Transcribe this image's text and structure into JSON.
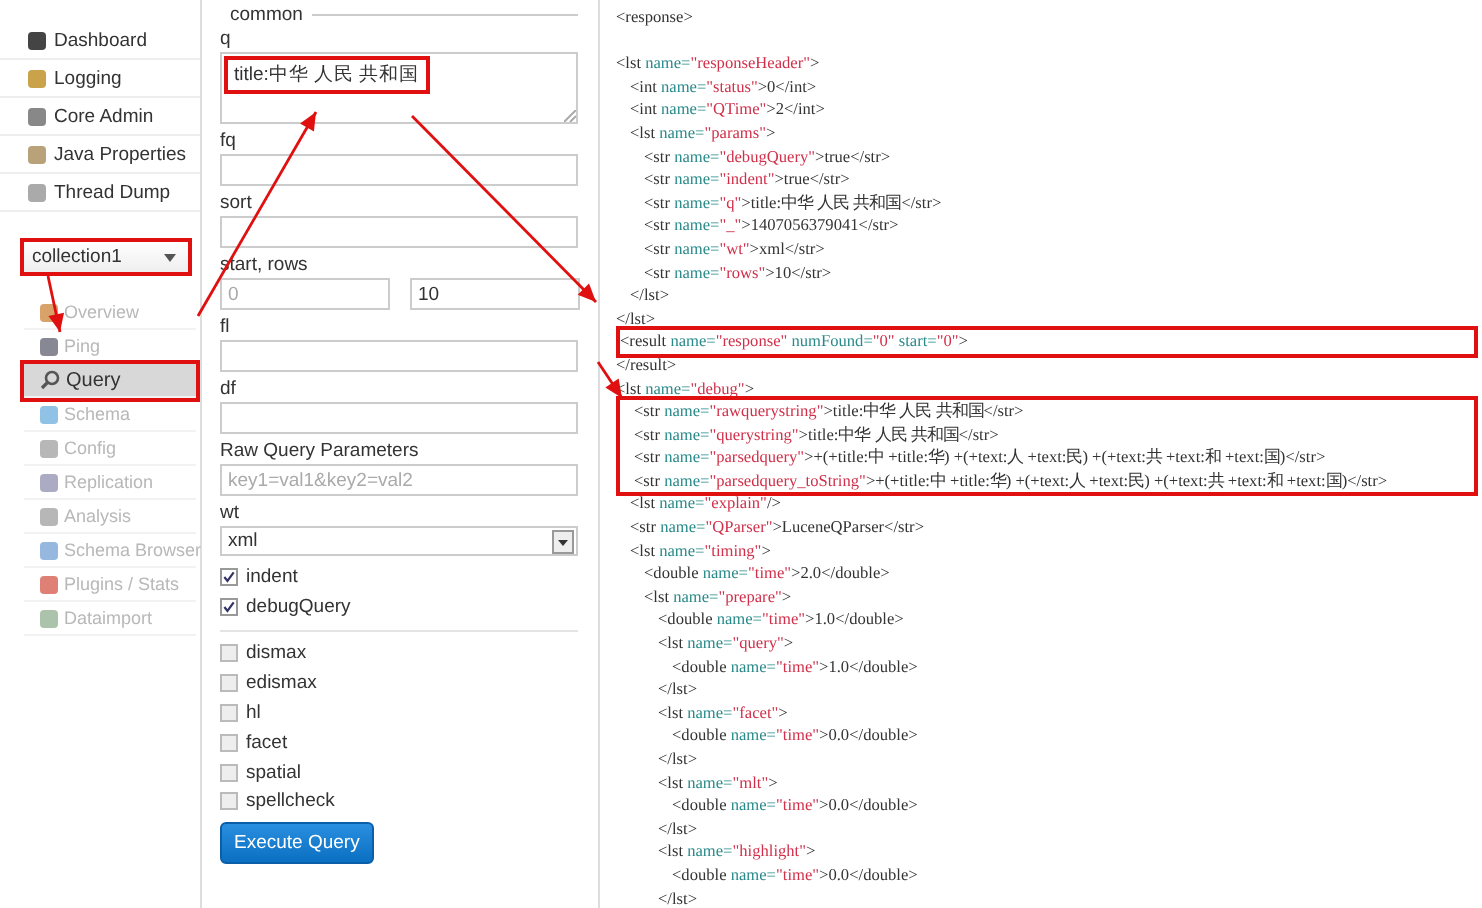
{
  "sidebar": {
    "items": [
      {
        "label": "Dashboard"
      },
      {
        "label": "Logging"
      },
      {
        "label": "Core Admin"
      },
      {
        "label": "Java Properties"
      },
      {
        "label": "Thread Dump"
      }
    ],
    "core_selector": {
      "value": "collection1",
      "highlighted": true
    },
    "core_items": [
      {
        "label": "Overview",
        "selected": false,
        "highlighted": false
      },
      {
        "label": "Ping",
        "selected": false,
        "highlighted": false
      },
      {
        "label": "Query",
        "selected": true,
        "highlighted": true
      },
      {
        "label": "Schema",
        "selected": false,
        "highlighted": false
      },
      {
        "label": "Config",
        "selected": false,
        "highlighted": false
      },
      {
        "label": "Replication",
        "selected": false,
        "highlighted": false
      },
      {
        "label": "Analysis",
        "selected": false,
        "highlighted": false
      },
      {
        "label": "Schema Browser",
        "selected": false,
        "highlighted": false
      },
      {
        "label": "Plugins / Stats",
        "selected": false,
        "highlighted": false
      },
      {
        "label": "Dataimport",
        "selected": false,
        "highlighted": false
      }
    ]
  },
  "form": {
    "legend": "common",
    "fields": [
      {
        "kind": "textarea",
        "label": "q",
        "value": "title:中华 人民 共和国",
        "highlighted": true
      },
      {
        "kind": "text",
        "label": "fq",
        "highlighted": false
      },
      {
        "kind": "text",
        "label": "sort",
        "highlighted": false
      },
      {
        "kind": "pair",
        "label": "start, rows",
        "inputs": [
          {
            "placeholder": "0"
          },
          {
            "value": "10"
          }
        ]
      },
      {
        "kind": "text",
        "label": "fl",
        "highlighted": false
      },
      {
        "kind": "text",
        "label": "df",
        "highlighted": false
      },
      {
        "kind": "text",
        "label": "Raw Query Parameters",
        "placeholder": "key1=val1&key2=val2",
        "highlighted": false
      },
      {
        "kind": "select",
        "label": "wt",
        "value": "xml"
      },
      {
        "kind": "checkbox",
        "label": "indent",
        "checked": true
      },
      {
        "kind": "checkbox",
        "label": "debugQuery",
        "checked": true
      },
      {
        "kind": "divider"
      },
      {
        "kind": "checkbox",
        "label": "dismax",
        "checked": false
      },
      {
        "kind": "checkbox",
        "label": "edismax",
        "checked": false
      },
      {
        "kind": "checkbox",
        "label": "hl",
        "checked": false
      },
      {
        "kind": "checkbox",
        "label": "facet",
        "checked": false
      },
      {
        "kind": "checkbox",
        "label": "spatial",
        "checked": false
      },
      {
        "kind": "checkbox",
        "label": "spellcheck",
        "checked": false
      },
      {
        "kind": "button",
        "label": "Execute Query"
      }
    ]
  },
  "response": {
    "nodes": [
      {
        "parts": [
          {
            "kind": "tag",
            "text": "<response>"
          }
        ],
        "children": [
          {
            "parts": [
              {
                "kind": "tag",
                "text": "<lst "
              },
              {
                "kind": "attr",
                "text": "name="
              },
              {
                "kind": "value",
                "text": "\"responseHeader\""
              },
              {
                "kind": "tag",
                "text": ">"
              }
            ],
            "children": [
              {
                "parts": [
                  {
                    "kind": "tag",
                    "text": "<int "
                  },
                  {
                    "kind": "attr",
                    "text": "name="
                  },
                  {
                    "kind": "value",
                    "text": "\"status\""
                  },
                  {
                    "kind": "tag",
                    "text": ">0</int>"
                  }
                ]
              },
              {
                "parts": [
                  {
                    "kind": "tag",
                    "text": "<int "
                  },
                  {
                    "kind": "attr",
                    "text": "name="
                  },
                  {
                    "kind": "value",
                    "text": "\"QTime\""
                  },
                  {
                    "kind": "tag",
                    "text": ">2</int>"
                  }
                ]
              },
              {
                "parts": [
                  {
                    "kind": "tag",
                    "text": "<lst "
                  },
                  {
                    "kind": "attr",
                    "text": "name="
                  },
                  {
                    "kind": "value",
                    "text": "\"params\""
                  },
                  {
                    "kind": "tag",
                    "text": ">"
                  }
                ],
                "children": [
                  {
                    "parts": [
                      {
                        "kind": "tag",
                        "text": "<str "
                      },
                      {
                        "kind": "attr",
                        "text": "name="
                      },
                      {
                        "kind": "value",
                        "text": "\"debugQuery\""
                      },
                      {
                        "kind": "tag",
                        "text": ">true</str>"
                      }
                    ]
                  },
                  {
                    "parts": [
                      {
                        "kind": "tag",
                        "text": "<str "
                      },
                      {
                        "kind": "attr",
                        "text": "name="
                      },
                      {
                        "kind": "value",
                        "text": "\"indent\""
                      },
                      {
                        "kind": "tag",
                        "text": ">true</str>"
                      }
                    ]
                  },
                  {
                    "parts": [
                      {
                        "kind": "tag",
                        "text": "<str "
                      },
                      {
                        "kind": "attr",
                        "text": "name="
                      },
                      {
                        "kind": "value",
                        "text": "\"q\""
                      },
                      {
                        "kind": "tag",
                        "text": ">title:中华 人民 共和国</str>"
                      }
                    ]
                  },
                  {
                    "parts": [
                      {
                        "kind": "tag",
                        "text": "<str "
                      },
                      {
                        "kind": "attr",
                        "text": "name="
                      },
                      {
                        "kind": "value",
                        "text": "\"_\""
                      },
                      {
                        "kind": "tag",
                        "text": ">1407056379041</str>"
                      }
                    ]
                  },
                  {
                    "parts": [
                      {
                        "kind": "tag",
                        "text": "<str "
                      },
                      {
                        "kind": "attr",
                        "text": "name="
                      },
                      {
                        "kind": "value",
                        "text": "\"wt\""
                      },
                      {
                        "kind": "tag",
                        "text": ">xml</str>"
                      }
                    ]
                  },
                  {
                    "parts": [
                      {
                        "kind": "tag",
                        "text": "<str "
                      },
                      {
                        "kind": "attr",
                        "text": "name="
                      },
                      {
                        "kind": "value",
                        "text": "\"rows\""
                      },
                      {
                        "kind": "tag",
                        "text": ">10</str>"
                      }
                    ]
                  }
                ],
                "close": [
                  {
                    "kind": "tag",
                    "text": "</lst>"
                  }
                ]
              }
            ],
            "close": [
              {
                "kind": "tag",
                "text": "</lst>"
              }
            ]
          },
          {
            "highlighted": true,
            "parts": [
              {
                "kind": "tag",
                "text": "<result "
              },
              {
                "kind": "attr",
                "text": "name="
              },
              {
                "kind": "value",
                "text": "\"response\""
              },
              {
                "kind": "attr",
                "text": " numFound="
              },
              {
                "kind": "value",
                "text": "\"0\""
              },
              {
                "kind": "attr",
                "text": " start="
              },
              {
                "kind": "value",
                "text": "\"0\""
              },
              {
                "kind": "tag",
                "text": ">"
              }
            ],
            "close": [
              {
                "kind": "tag",
                "text": "</result>"
              }
            ]
          },
          {
            "parts": [
              {
                "kind": "tag",
                "text": "<lst "
              },
              {
                "kind": "attr",
                "text": "name="
              },
              {
                "kind": "value",
                "text": "\"debug\""
              },
              {
                "kind": "tag",
                "text": ">"
              }
            ],
            "children": [
              {
                "highlighted": true,
                "parts": [
                  {
                    "kind": "tag",
                    "text": "<str "
                  },
                  {
                    "kind": "attr",
                    "text": "name="
                  },
                  {
                    "kind": "value",
                    "text": "\"rawquerystring\""
                  },
                  {
                    "kind": "tag",
                    "text": ">title:中华 人民 共和国</str>"
                  }
                ]
              },
              {
                "highlighted": true,
                "parts": [
                  {
                    "kind": "tag",
                    "text": "<str "
                  },
                  {
                    "kind": "attr",
                    "text": "name="
                  },
                  {
                    "kind": "value",
                    "text": "\"querystring\""
                  },
                  {
                    "kind": "tag",
                    "text": ">title:中华 人民 共和国</str>"
                  }
                ]
              },
              {
                "highlighted": true,
                "parts": [
                  {
                    "kind": "tag",
                    "text": "<str "
                  },
                  {
                    "kind": "attr",
                    "text": "name="
                  },
                  {
                    "kind": "value",
                    "text": "\"parsedquery\""
                  },
                  {
                    "kind": "tag",
                    "text": ">+(+title:中 +title:华) +(+text:人 +text:民) +(+text:共 +text:和 +text:国)</str>"
                  }
                ]
              },
              {
                "highlighted": true,
                "parts": [
                  {
                    "kind": "tag",
                    "text": "<str "
                  },
                  {
                    "kind": "attr",
                    "text": "name="
                  },
                  {
                    "kind": "value",
                    "text": "\"parsedquery_toString\""
                  },
                  {
                    "kind": "tag",
                    "text": ">+(+title:中 +title:华) +(+text:人 +text:民) +(+text:共 +text:和 +text:国)</str>"
                  }
                ]
              },
              {
                "parts": [
                  {
                    "kind": "tag",
                    "text": "<lst "
                  },
                  {
                    "kind": "attr",
                    "text": "name="
                  },
                  {
                    "kind": "value",
                    "text": "\"explain\""
                  },
                  {
                    "kind": "tag",
                    "text": "/>"
                  }
                ]
              },
              {
                "parts": [
                  {
                    "kind": "tag",
                    "text": "<str "
                  },
                  {
                    "kind": "attr",
                    "text": "name="
                  },
                  {
                    "kind": "value",
                    "text": "\"QParser\""
                  },
                  {
                    "kind": "tag",
                    "text": ">LuceneQParser</str>"
                  }
                ]
              },
              {
                "parts": [
                  {
                    "kind": "tag",
                    "text": "<lst "
                  },
                  {
                    "kind": "attr",
                    "text": "name="
                  },
                  {
                    "kind": "value",
                    "text": "\"timing\""
                  },
                  {
                    "kind": "tag",
                    "text": ">"
                  }
                ],
                "children": [
                  {
                    "parts": [
                      {
                        "kind": "tag",
                        "text": "<double "
                      },
                      {
                        "kind": "attr",
                        "text": "name="
                      },
                      {
                        "kind": "value",
                        "text": "\"time\""
                      },
                      {
                        "kind": "tag",
                        "text": ">2.0</double>"
                      }
                    ]
                  },
                  {
                    "parts": [
                      {
                        "kind": "tag",
                        "text": "<lst "
                      },
                      {
                        "kind": "attr",
                        "text": "name="
                      },
                      {
                        "kind": "value",
                        "text": "\"prepare\""
                      },
                      {
                        "kind": "tag",
                        "text": ">"
                      }
                    ],
                    "children": [
                      {
                        "parts": [
                          {
                            "kind": "tag",
                            "text": "<double "
                          },
                          {
                            "kind": "attr",
                            "text": "name="
                          },
                          {
                            "kind": "value",
                            "text": "\"time\""
                          },
                          {
                            "kind": "tag",
                            "text": ">1.0</double>"
                          }
                        ]
                      },
                      {
                        "parts": [
                          {
                            "kind": "tag",
                            "text": "<lst "
                          },
                          {
                            "kind": "attr",
                            "text": "name="
                          },
                          {
                            "kind": "value",
                            "text": "\"query\""
                          },
                          {
                            "kind": "tag",
                            "text": ">"
                          }
                        ],
                        "children": [
                          {
                            "parts": [
                              {
                                "kind": "tag",
                                "text": "<double "
                              },
                              {
                                "kind": "attr",
                                "text": "name="
                              },
                              {
                                "kind": "value",
                                "text": "\"time\""
                              },
                              {
                                "kind": "tag",
                                "text": ">1.0</double>"
                              }
                            ]
                          }
                        ],
                        "close": [
                          {
                            "kind": "tag",
                            "text": "</lst>"
                          }
                        ]
                      },
                      {
                        "parts": [
                          {
                            "kind": "tag",
                            "text": "<lst "
                          },
                          {
                            "kind": "attr",
                            "text": "name="
                          },
                          {
                            "kind": "value",
                            "text": "\"facet\""
                          },
                          {
                            "kind": "tag",
                            "text": ">"
                          }
                        ],
                        "children": [
                          {
                            "parts": [
                              {
                                "kind": "tag",
                                "text": "<double "
                              },
                              {
                                "kind": "attr",
                                "text": "name="
                              },
                              {
                                "kind": "value",
                                "text": "\"time\""
                              },
                              {
                                "kind": "tag",
                                "text": ">0.0</double>"
                              }
                            ]
                          }
                        ],
                        "close": [
                          {
                            "kind": "tag",
                            "text": "</lst>"
                          }
                        ]
                      },
                      {
                        "parts": [
                          {
                            "kind": "tag",
                            "text": "<lst "
                          },
                          {
                            "kind": "attr",
                            "text": "name="
                          },
                          {
                            "kind": "value",
                            "text": "\"mlt\""
                          },
                          {
                            "kind": "tag",
                            "text": ">"
                          }
                        ],
                        "children": [
                          {
                            "parts": [
                              {
                                "kind": "tag",
                                "text": "<double "
                              },
                              {
                                "kind": "attr",
                                "text": "name="
                              },
                              {
                                "kind": "value",
                                "text": "\"time\""
                              },
                              {
                                "kind": "tag",
                                "text": ">0.0</double>"
                              }
                            ]
                          }
                        ],
                        "close": [
                          {
                            "kind": "tag",
                            "text": "</lst>"
                          }
                        ]
                      },
                      {
                        "parts": [
                          {
                            "kind": "tag",
                            "text": "<lst "
                          },
                          {
                            "kind": "attr",
                            "text": "name="
                          },
                          {
                            "kind": "value",
                            "text": "\"highlight\""
                          },
                          {
                            "kind": "tag",
                            "text": ">"
                          }
                        ],
                        "children": [
                          {
                            "parts": [
                              {
                                "kind": "tag",
                                "text": "<double "
                              },
                              {
                                "kind": "attr",
                                "text": "name="
                              },
                              {
                                "kind": "value",
                                "text": "\"time\""
                              },
                              {
                                "kind": "tag",
                                "text": ">0.0</double>"
                              }
                            ]
                          }
                        ],
                        "close": [
                          {
                            "kind": "tag",
                            "text": "</lst>"
                          }
                        ]
                      }
                    ]
                  }
                ]
              }
            ]
          }
        ]
      }
    ]
  }
}
